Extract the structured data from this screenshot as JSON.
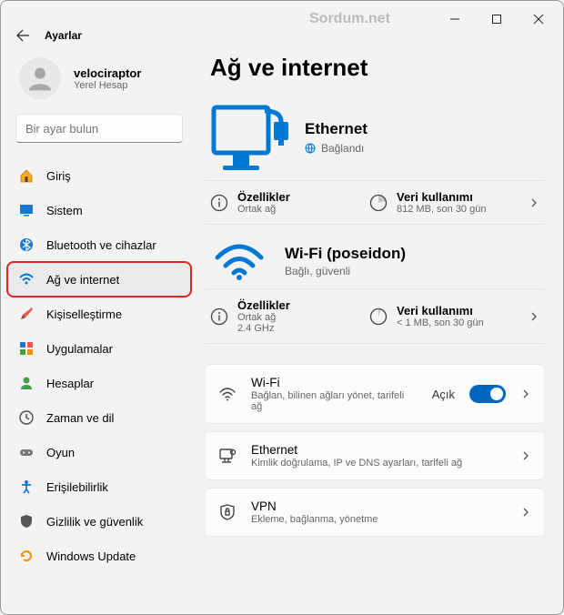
{
  "titlebar": {
    "watermark": "Sordum.net"
  },
  "header": {
    "title": "Ayarlar"
  },
  "user": {
    "name": "velociraptor",
    "sub": "Yerel Hesap"
  },
  "search": {
    "placeholder": "Bir ayar bulun"
  },
  "nav": {
    "items": [
      {
        "label": "Giriş"
      },
      {
        "label": "Sistem"
      },
      {
        "label": "Bluetooth ve cihazlar"
      },
      {
        "label": "Ağ ve internet"
      },
      {
        "label": "Kişiselleştirme"
      },
      {
        "label": "Uygulamalar"
      },
      {
        "label": "Hesaplar"
      },
      {
        "label": "Zaman ve dil"
      },
      {
        "label": "Oyun"
      },
      {
        "label": "Erişilebilirlik"
      },
      {
        "label": "Gizlilik ve güvenlik"
      },
      {
        "label": "Windows Update"
      }
    ]
  },
  "page": {
    "title": "Ağ ve internet"
  },
  "ethernet": {
    "name": "Ethernet",
    "status": "Bağlandı",
    "props_title": "Özellikler",
    "props_sub": "Ortak ağ",
    "usage_title": "Veri kullanımı",
    "usage_sub": "812 MB, son 30 gün"
  },
  "wifi": {
    "name": "Wi-Fi (poseidon)",
    "status": "Bağlı, güvenli",
    "props_title": "Özellikler",
    "props_sub1": "Ortak ağ",
    "props_sub2": "2.4 GHz",
    "usage_title": "Veri kullanımı",
    "usage_sub": "< 1 MB, son 30 gün"
  },
  "cards": {
    "wifi": {
      "title": "Wi-Fi",
      "sub": "Bağlan, bilinen ağları yönet, tarifeli ağ",
      "state": "Açık"
    },
    "ethernet": {
      "title": "Ethernet",
      "sub": "Kimlik doğrulama, IP ve DNS ayarları, tarifeli ağ"
    },
    "vpn": {
      "title": "VPN",
      "sub": "Ekleme, bağlanma, yönetme"
    }
  }
}
